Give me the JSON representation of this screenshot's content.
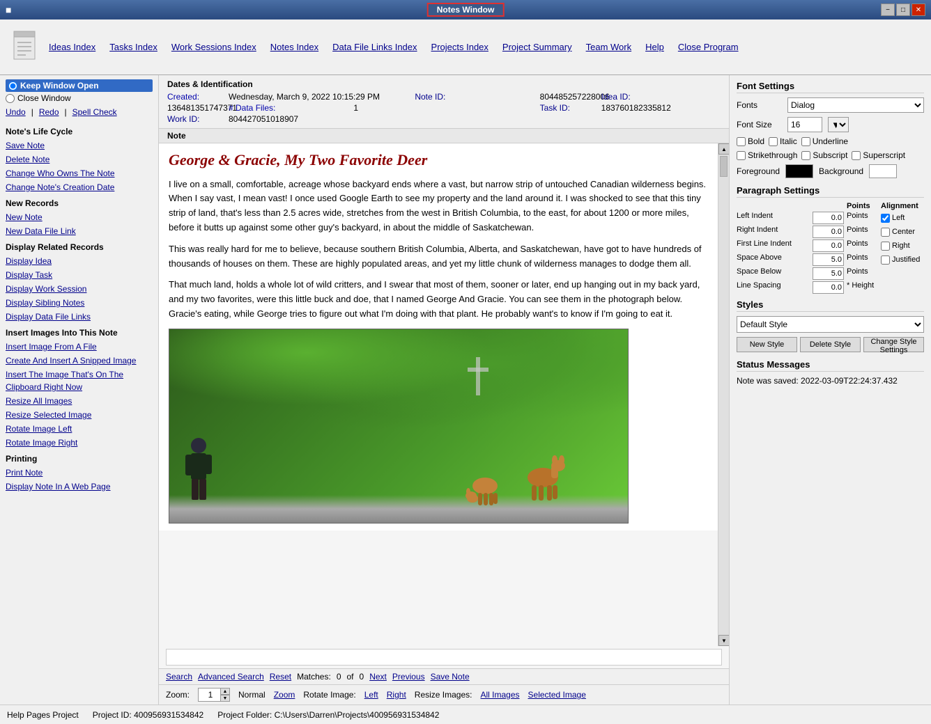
{
  "window": {
    "title": "Notes Window"
  },
  "menu": {
    "items": [
      {
        "id": "ideas-index",
        "label": "Ideas Index"
      },
      {
        "id": "tasks-index",
        "label": "Tasks Index"
      },
      {
        "id": "work-sessions-index",
        "label": "Work Sessions Index"
      },
      {
        "id": "notes-index",
        "label": "Notes Index"
      },
      {
        "id": "data-file-links-index",
        "label": "Data File Links Index"
      },
      {
        "id": "projects-index",
        "label": "Projects Index"
      },
      {
        "id": "project-summary",
        "label": "Project Summary"
      },
      {
        "id": "team-work",
        "label": "Team Work"
      },
      {
        "id": "help",
        "label": "Help"
      },
      {
        "id": "close-program",
        "label": "Close Program"
      }
    ]
  },
  "sidebar": {
    "keep_window_open": "Keep Window Open",
    "close_window": "Close Window",
    "undo": "Undo",
    "redo": "Redo",
    "spell_check": "Spell Check",
    "notes_life_cycle": "Note's Life Cycle",
    "save_note": "Save Note",
    "delete_note": "Delete Note",
    "change_who_owns_the_note": "Change Who Owns The Note",
    "change_notes_creation_date": "Change Note's Creation Date",
    "new_records": "New Records",
    "new_note": "New Note",
    "new_data_file_link": "New Data File Link",
    "display_related_records": "Display Related Records",
    "display_idea": "Display Idea",
    "display_task": "Display Task",
    "display_work_session": "Display Work Session",
    "display_sibling_notes": "Display Sibling Notes",
    "display_data_file_links": "Display Data File Links",
    "insert_images_title": "Insert Images Into This Note",
    "insert_image_from_file": "Insert Image From A File",
    "create_and_insert_snipped": "Create And Insert A Snipped Image",
    "insert_image_clipboard": "Insert The Image That's On The Clipboard Right Now",
    "resize_all_images": "Resize All Images",
    "resize_selected_image": "Resize Selected Image",
    "rotate_image_left": "Rotate Image Left",
    "rotate_image_right": "Rotate Image Right",
    "printing_title": "Printing",
    "print_note": "Print Note",
    "display_note_web": "Display Note In A Web Page"
  },
  "dates": {
    "section_title": "Dates & Identification",
    "created_label": "Created:",
    "created_value": "Wednesday, March 9, 2022  10:15:29 PM",
    "data_files_label": "# Data Files:",
    "data_files_value": "1",
    "note_id_label": "Note ID:",
    "note_id_value": "804485257228006",
    "idea_id_label": "Idea ID:",
    "idea_id_value": "136481351747371",
    "task_id_label": "Task ID:",
    "task_id_value": "183760182335812",
    "work_id_label": "Work ID:",
    "work_id_value": "804427051018907"
  },
  "note": {
    "section_title": "Note",
    "title": "George & Gracie, My Two Favorite Deer",
    "paragraph1": "I live on a small, comfortable, acreage whose backyard ends where a vast, but narrow strip of untouched Canadian wilderness begins. When I say vast, I mean vast! I once used Google Earth to see my property and the land around it. I was shocked to see that this tiny strip of land, that's less than 2.5 acres wide, stretches from the west in British Columbia, to the east, for about 1200 or more miles, before it butts up against some other guy's backyard, in about the middle of Saskatchewan.",
    "paragraph2": "This was really hard for me to believe, because southern British Columbia, Alberta, and Saskatchewan, have got to have hundreds of thousands of houses on them. These are highly populated areas, and yet my little chunk of wilderness manages to dodge them all.",
    "paragraph3": "That much land, holds a whole lot of wild critters, and I swear that most of them, sooner or later, end up hanging out in my back yard, and my two favorites, were this little buck and doe, that I named George And Gracie. You can see them in the photograph below. Gracie's eating, while George tries to figure out what I'm doing with that plant. He probably want's to know if I'm going to eat it."
  },
  "search": {
    "search_label": "Search",
    "advanced_label": "Advanced Search",
    "reset_label": "Reset",
    "matches_label": "Matches:",
    "matches_value": "0",
    "of_label": "of",
    "total_value": "0",
    "next_label": "Next",
    "previous_label": "Previous",
    "save_note_label": "Save Note"
  },
  "toolbar": {
    "zoom_label": "Zoom:",
    "zoom_value": "1",
    "normal_label": "Normal",
    "zoom_link": "Zoom",
    "rotate_image_label": "Rotate Image:",
    "left_label": "Left",
    "right_label": "Right",
    "resize_images_label": "Resize Images:",
    "all_images_label": "All Images",
    "selected_image_label": "Selected Image"
  },
  "font_settings": {
    "title": "Font Settings",
    "fonts_label": "Fonts",
    "fonts_value": "Dialog",
    "font_size_label": "Font Size",
    "font_size_value": "16",
    "bold_label": "Bold",
    "italic_label": "Italic",
    "underline_label": "Underline",
    "strikethrough_label": "Strikethrough",
    "subscript_label": "Subscript",
    "superscript_label": "Superscript",
    "foreground_label": "Foreground",
    "background_label": "Background"
  },
  "paragraph_settings": {
    "title": "Paragraph Settings",
    "left_indent_label": "Left Indent",
    "left_indent_value": "0.0",
    "right_indent_label": "Right Indent",
    "right_indent_value": "0.0",
    "first_line_indent_label": "First Line Indent",
    "first_line_indent_value": "0.0",
    "space_above_label": "Space Above",
    "space_above_value": "5.0",
    "space_below_label": "Space Below",
    "space_below_value": "5.0",
    "line_spacing_label": "Line Spacing",
    "line_spacing_value": "0.0",
    "points_label": "Points",
    "alignment_label": "Alignment",
    "left_check": "Left",
    "center_check": "Center",
    "right_check": "Right",
    "justified_check": "Justified",
    "height_label": "* Height"
  },
  "styles": {
    "title": "Styles",
    "default_style": "Default Style",
    "new_style": "New Style",
    "delete_style": "Delete Style",
    "change_style_settings": "Change Style Settings"
  },
  "status_messages": {
    "title": "Status Messages",
    "message": "Note was saved:  2022-03-09T22:24:37.432"
  },
  "status_bar": {
    "project": "Help Pages Project",
    "project_id_label": "Project ID:",
    "project_id": "400956931534842",
    "project_folder_label": "Project Folder:",
    "project_folder": "C:\\Users\\Darren\\Projects\\400956931534842"
  }
}
